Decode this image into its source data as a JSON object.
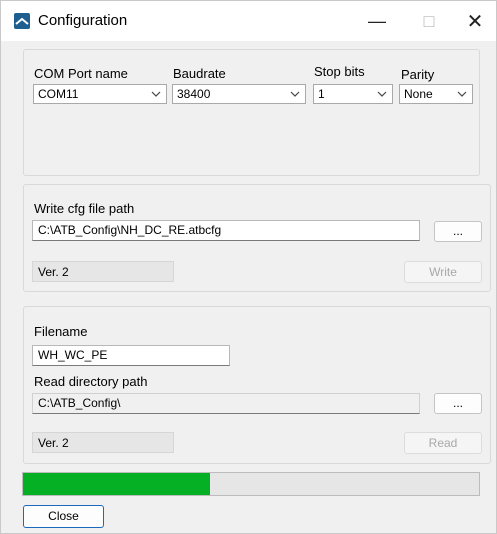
{
  "window": {
    "title": "Configuration",
    "icon": "app-icon",
    "controls": [
      "minimize-icon",
      "maximize-icon",
      "close-icon"
    ]
  },
  "com_settings": {
    "port": {
      "label": "COM Port name",
      "value": "COM11"
    },
    "baud": {
      "label": "Baudrate",
      "value": "38400"
    },
    "stop": {
      "label": "Stop bits",
      "value": "1"
    },
    "parity": {
      "label": "Parity",
      "value": "None"
    }
  },
  "write_group": {
    "path_label": "Write cfg file path",
    "path_value": "C:\\ATB_Config\\NH_DC_RE.atbcfg",
    "browse_label": "...",
    "version": "Ver. 2",
    "write_label": "Write"
  },
  "read_group": {
    "filename_label": "Filename",
    "filename_value": "WH_WC_PE",
    "dir_label": "Read directory path",
    "dir_value": "C:\\ATB_Config\\",
    "browse_label": "...",
    "version": "Ver. 2",
    "read_label": "Read"
  },
  "progress": {
    "value_fraction": 0.41,
    "color": "#06b025"
  },
  "footer": {
    "close_label": "Close"
  }
}
